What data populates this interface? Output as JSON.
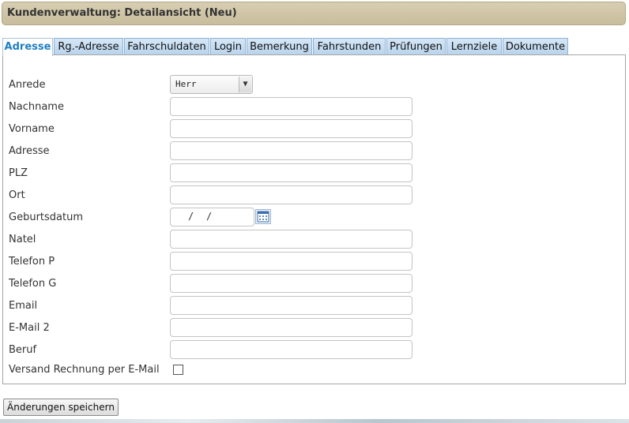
{
  "header": {
    "title": "Kundenverwaltung: Detailansicht (Neu)"
  },
  "tabs": [
    {
      "label": "Adresse",
      "active": true
    },
    {
      "label": "Rg.-Adresse",
      "active": false
    },
    {
      "label": "Fahrschuldaten",
      "active": false
    },
    {
      "label": "Login",
      "active": false
    },
    {
      "label": "Bemerkung",
      "active": false
    },
    {
      "label": "Fahrstunden",
      "active": false
    },
    {
      "label": "Prüfungen",
      "active": false
    },
    {
      "label": "Lernziele",
      "active": false
    },
    {
      "label": "Dokumente",
      "active": false
    }
  ],
  "form": {
    "anrede": {
      "label": "Anrede",
      "value": "Herr"
    },
    "nachname": {
      "label": "Nachname",
      "value": ""
    },
    "vorname": {
      "label": "Vorname",
      "value": ""
    },
    "adresse": {
      "label": "Adresse",
      "value": ""
    },
    "plz": {
      "label": "PLZ",
      "value": ""
    },
    "ort": {
      "label": "Ort",
      "value": ""
    },
    "geburtsdatum": {
      "label": "Geburtsdatum",
      "separator": "/"
    },
    "natel": {
      "label": "Natel",
      "value": ""
    },
    "telefon_p": {
      "label": "Telefon P",
      "value": ""
    },
    "telefon_g": {
      "label": "Telefon G",
      "value": ""
    },
    "email": {
      "label": "Email",
      "value": ""
    },
    "email2": {
      "label": "E-Mail 2",
      "value": ""
    },
    "beruf": {
      "label": "Beruf",
      "value": ""
    },
    "versand": {
      "label": "Versand Rechnung per E-Mail",
      "checked": false
    }
  },
  "actions": {
    "save_label": "Änderungen speichern"
  },
  "icons": {
    "select_arrow": "chevron-down-icon",
    "calendar": "calendar-icon"
  },
  "colors": {
    "header_bg": "#c8bd9c",
    "tab_bg": "#b8d3ec",
    "active_tab_text": "#1f7fc4"
  }
}
